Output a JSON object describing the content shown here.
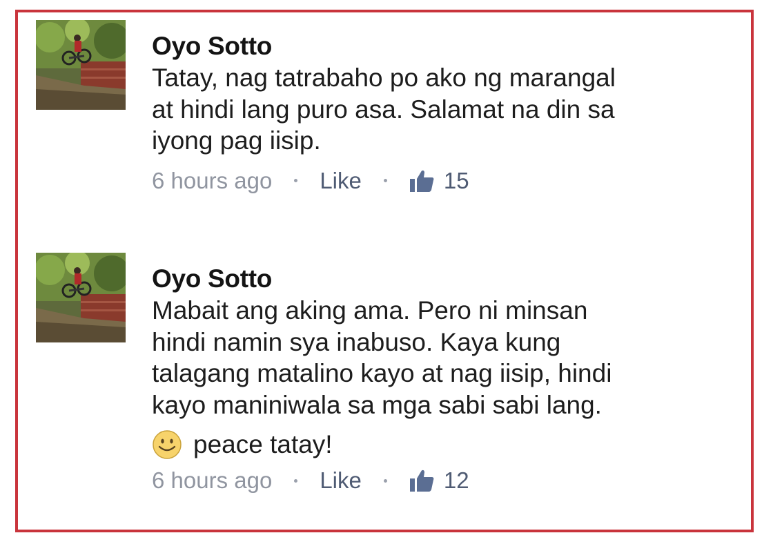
{
  "comments": [
    {
      "author": "Oyo Sotto",
      "lines": [
        "Tatay, nag tatrabaho po ako ng marangal",
        "at hindi lang puro asa. Salamat na din sa",
        "iyong pag iisip."
      ],
      "emoji_text": "",
      "time": "6 hours ago",
      "like_label": "Like",
      "like_count": "15",
      "avatar_icon": "profile-photo-bike-jump"
    },
    {
      "author": "Oyo Sotto",
      "lines": [
        "Mabait ang aking ama. Pero ni minsan",
        "hindi namin sya inabuso. Kaya kung",
        "talagang matalino kayo at nag iisip, hindi",
        "kayo maniniwala sa mga sabi sabi lang."
      ],
      "emoji_text": "peace tatay!",
      "emoji_icon": "smiley-emoji",
      "time": "6 hours ago",
      "like_label": "Like",
      "like_count": "12",
      "avatar_icon": "profile-photo-bike-jump"
    }
  ],
  "colors": {
    "frame_border": "#c9343c",
    "author": "#141414",
    "meta_time": "#9095a0",
    "meta_link": "#4f5b73",
    "emoji_yellow": "#f7d36b"
  }
}
